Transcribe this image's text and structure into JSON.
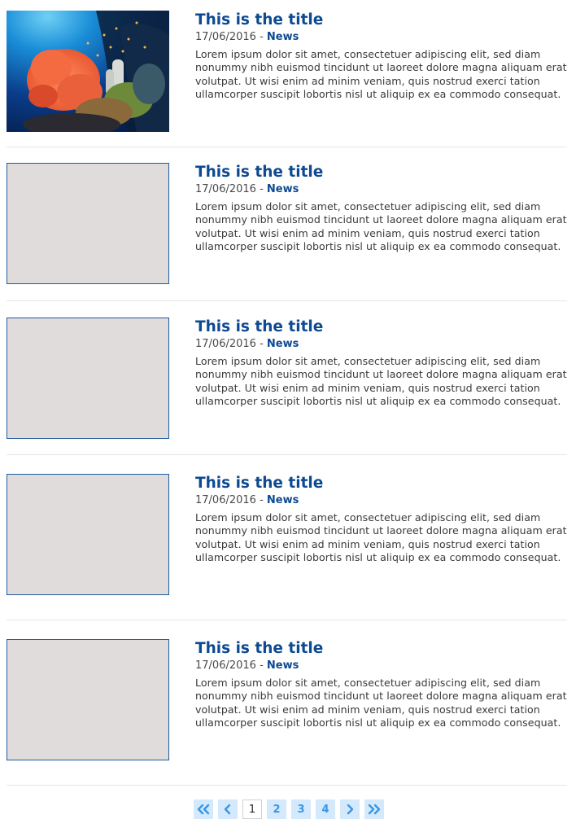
{
  "articles": [
    {
      "title": "This is the title",
      "date": "17/06/2016",
      "separator": "-",
      "category": "News",
      "excerpt": "Lorem ipsum dolor sit amet, consectetuer adipiscing elit, sed diam nonummy nibh euismod tincidunt ut laoreet dolore magna aliquam erat volutpat. Ut wisi enim ad minim veniam, quis nostrud exerci tation ullamcorper suscipit lobortis nisl ut aliquip ex ea commodo consequat.",
      "image": "coral-reef-photo"
    },
    {
      "title": "This is the title",
      "date": "17/06/2016",
      "separator": "-",
      "category": "News",
      "excerpt": "Lorem ipsum dolor sit amet, consectetuer adipiscing elit, sed diam nonummy nibh euismod tincidunt ut laoreet dolore magna aliquam erat volutpat. Ut wisi enim ad minim veniam, quis nostrud exerci tation ullamcorper suscipit lobortis nisl ut aliquip ex ea commodo consequat.",
      "image": "placeholder"
    },
    {
      "title": "This is the title",
      "date": "17/06/2016",
      "separator": "-",
      "category": "News",
      "excerpt": "Lorem ipsum dolor sit amet, consectetuer adipiscing elit, sed diam nonummy nibh euismod tincidunt ut laoreet dolore magna aliquam erat volutpat. Ut wisi enim ad minim veniam, quis nostrud exerci tation ullamcorper suscipit lobortis nisl ut aliquip ex ea commodo consequat.",
      "image": "placeholder"
    },
    {
      "title": "This is the title",
      "date": "17/06/2016",
      "separator": "-",
      "category": "News",
      "excerpt": "Lorem ipsum dolor sit amet, consectetuer adipiscing elit, sed diam nonummy nibh euismod tincidunt ut laoreet dolore magna aliquam erat volutpat. Ut wisi enim ad minim veniam, quis nostrud exerci tation ullamcorper suscipit lobortis nisl ut aliquip ex ea commodo consequat.",
      "image": "placeholder"
    },
    {
      "title": "This is the title",
      "date": "17/06/2016",
      "separator": "-",
      "category": "News",
      "excerpt": "Lorem ipsum dolor sit amet, consectetuer adipiscing elit, sed diam nonummy nibh euismod tincidunt ut laoreet dolore magna aliquam erat volutpat. Ut wisi enim ad minim veniam, quis nostrud exerci tation ullamcorper suscipit lobortis nisl ut aliquip ex ea commodo consequat.",
      "image": "placeholder"
    }
  ],
  "pagination": {
    "first_icon": "double-chevron-left-icon",
    "prev_icon": "chevron-left-icon",
    "pages": [
      "1",
      "2",
      "3",
      "4"
    ],
    "current_page": "1",
    "next_icon": "chevron-right-icon",
    "last_icon": "double-chevron-right-icon"
  },
  "colors": {
    "title": "#0d4a92",
    "category": "#0d4a92",
    "placeholder_fill": "#e0dcdb",
    "placeholder_border": "#1f5c9e",
    "pager_bg": "#d4e9fb",
    "pager_fg": "#3a96e6"
  }
}
